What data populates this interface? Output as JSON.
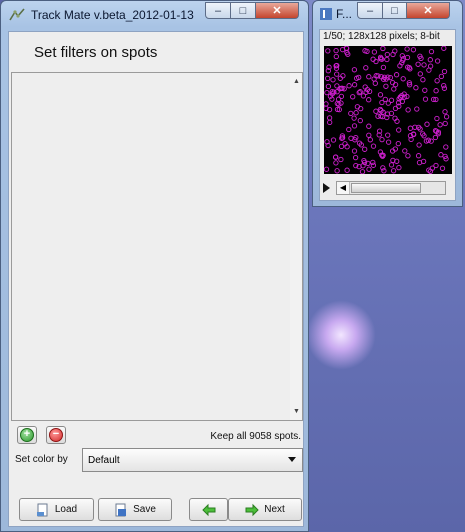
{
  "trackmate_window": {
    "title": "Track Mate v.beta_2012-01-13",
    "panel_title": "Set filters on spots",
    "add_symbol": "+",
    "remove_symbol": "−",
    "keep_text": "Keep all 9058 spots.",
    "color_label": "Set color by",
    "color_select_value": "Default",
    "buttons": {
      "load": "Load",
      "save": "Save",
      "next": "Next"
    }
  },
  "image_window": {
    "title": "F...",
    "info": "1/50; 128x128 pixels; 8-bit"
  },
  "window_controls": {
    "minimize": "–",
    "maximize": "□",
    "close": "✕"
  },
  "colors": {
    "spot_overlay": "#d020d0",
    "add_green": "#2f9a2f",
    "remove_red": "#d22a2a",
    "title_gradient_top": "#bcd3ee"
  },
  "icons": [
    "app-icon",
    "add-icon",
    "remove-icon",
    "load-icon",
    "save-icon",
    "back-arrow-icon",
    "next-arrow-icon",
    "play-icon"
  ]
}
